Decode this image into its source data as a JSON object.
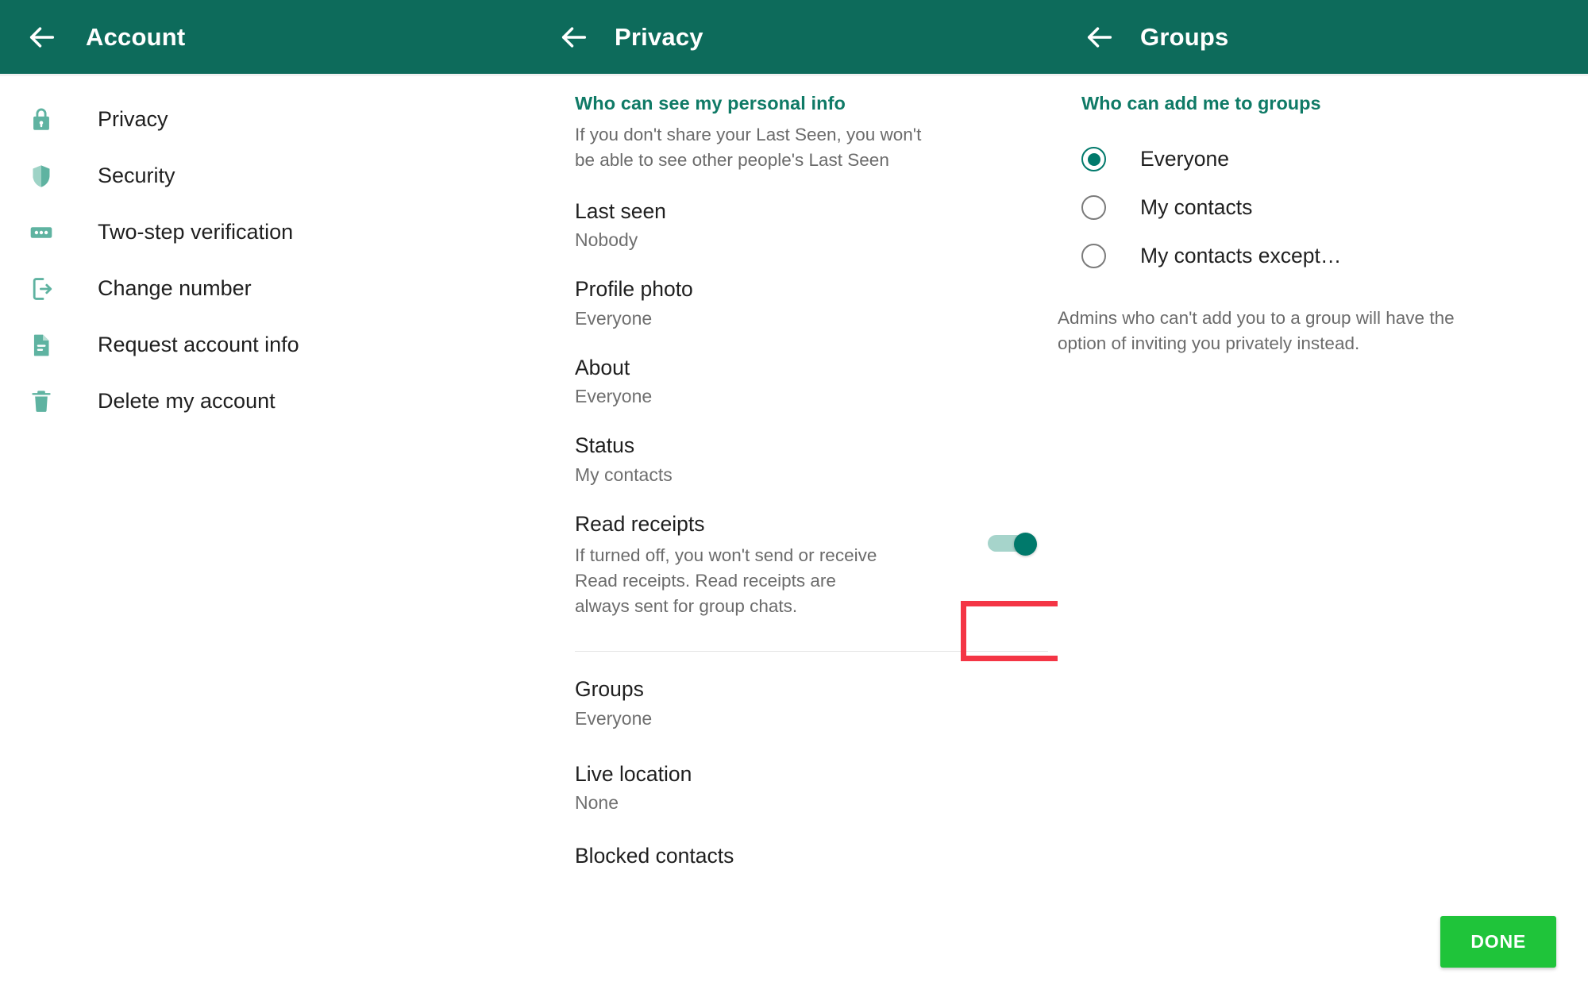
{
  "accountPanel": {
    "title": "Account",
    "back_icon": "back-arrow-icon",
    "items": [
      {
        "label": "Privacy",
        "icon": "lock-icon"
      },
      {
        "label": "Security",
        "icon": "shield-icon"
      },
      {
        "label": "Two-step verification",
        "icon": "dots-passcode-icon"
      },
      {
        "label": "Change number",
        "icon": "phone-exit-icon"
      },
      {
        "label": "Request account info",
        "icon": "document-icon"
      },
      {
        "label": "Delete my account",
        "icon": "trash-icon"
      }
    ]
  },
  "privacyPanel": {
    "title": "Privacy",
    "back_icon": "back-arrow-icon",
    "section_header": "Who can see my personal info",
    "section_desc": "If you don't share your Last Seen, you won't be able to see other people's Last Seen",
    "rows": [
      {
        "title": "Last seen",
        "value": "Nobody"
      },
      {
        "title": "Profile photo",
        "value": "Everyone"
      },
      {
        "title": "About",
        "value": "Everyone"
      },
      {
        "title": "Status",
        "value": "My contacts"
      }
    ],
    "read_receipts": {
      "title": "Read receipts",
      "desc": "If turned off, you won't send or receive Read receipts. Read receipts are always sent for group chats.",
      "toggle_on": true
    },
    "groups_row": {
      "title": "Groups",
      "value": "Everyone"
    },
    "live_location_row": {
      "title": "Live location",
      "value": "None"
    },
    "blocked_row": {
      "title": "Blocked contacts"
    },
    "highlight_color": "#f43545"
  },
  "groupsPanel": {
    "title": "Groups",
    "back_icon": "back-arrow-icon",
    "section_header": "Who can add me to groups",
    "options": [
      {
        "label": "Everyone",
        "selected": true
      },
      {
        "label": "My contacts",
        "selected": false
      },
      {
        "label": "My contacts except…",
        "selected": false
      }
    ],
    "note": "Admins who can't add you to a group will have the option of inviting you privately instead.",
    "done_label": "DONE"
  },
  "theme": {
    "appbar": "#0d6b5b",
    "accent": "#0f7a66",
    "toggle_on": "#00796b",
    "done_button": "#1fc43a",
    "icon_teal": "#5fb3a1"
  }
}
